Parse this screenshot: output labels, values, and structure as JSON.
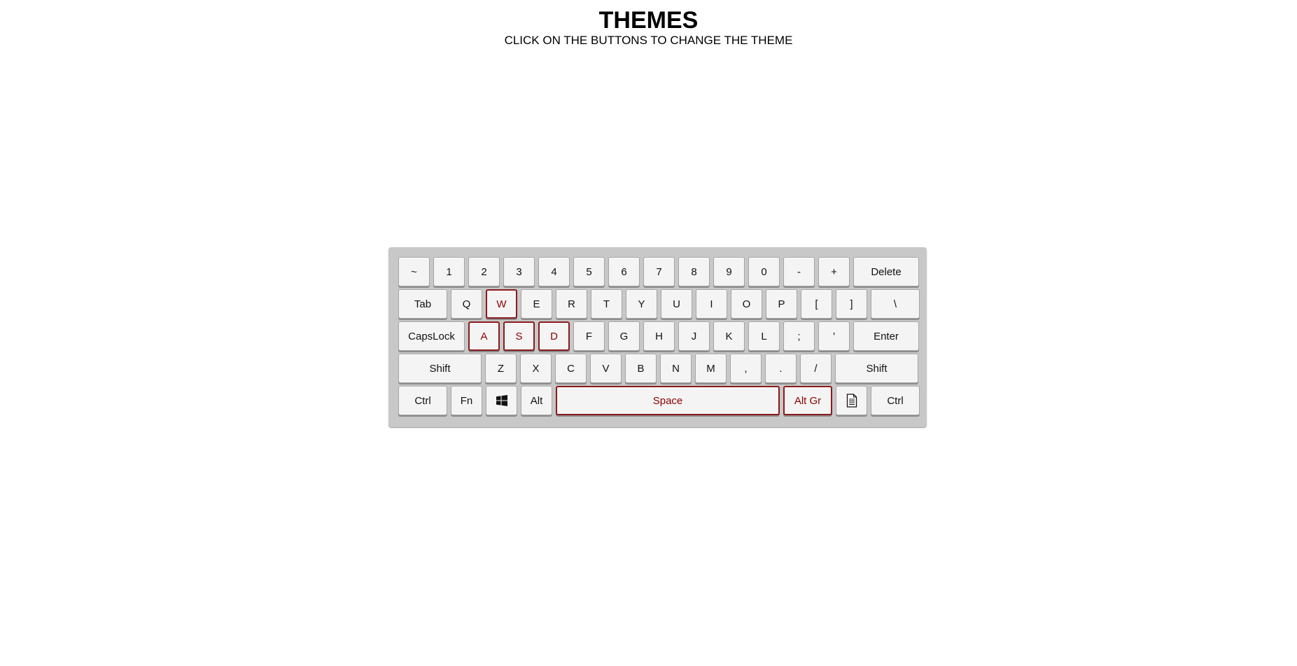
{
  "header": {
    "title": "THEMES",
    "subtitle": "CLICK ON THE BUTTONS TO CHANGE THE THEME"
  },
  "colors": {
    "keyboard_case": "#c8c8c8",
    "key_face": "#f4f4f4",
    "theme_key_accent": "#8b0000"
  },
  "keyboard": {
    "row1": [
      "~",
      "1",
      "2",
      "3",
      "4",
      "5",
      "6",
      "7",
      "8",
      "9",
      "0",
      "-",
      "+",
      "Delete"
    ],
    "row2": [
      "Tab",
      "Q",
      "W",
      "E",
      "R",
      "T",
      "Y",
      "U",
      "I",
      "O",
      "P",
      "[",
      "]",
      "\\"
    ],
    "row3": [
      "CapsLock",
      "A",
      "S",
      "D",
      "F",
      "G",
      "H",
      "J",
      "K",
      "L",
      ";",
      "'",
      "Enter"
    ],
    "row4": [
      "Shift",
      "Z",
      "X",
      "C",
      "V",
      "B",
      "N",
      "M",
      ",",
      ".",
      "/",
      "Shift"
    ],
    "row5": {
      "ctrl_left": "Ctrl",
      "fn": "Fn",
      "win_icon": "windows-logo-icon",
      "alt": "Alt",
      "space": "Space",
      "alt_gr": "Alt Gr",
      "menu_icon": "document-menu-icon",
      "ctrl_right": "Ctrl"
    },
    "theme_keys": [
      "W",
      "A",
      "S",
      "D",
      "Space",
      "Alt Gr"
    ]
  }
}
